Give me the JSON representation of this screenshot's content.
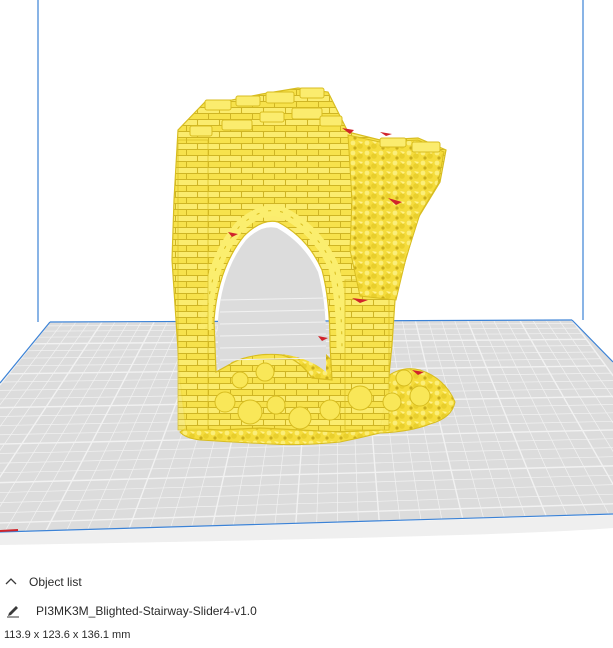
{
  "viewport": {
    "background": "#ffffff",
    "buildplate_color": "#dcdcdc",
    "grid_color": "#f2f2f2",
    "volume_edge_color": "#3b82d6",
    "model_color": "#f7e24c",
    "model_shadow_color": "#d8bd20",
    "overhang_color": "#d0242b"
  },
  "object_panel": {
    "toggle_icon": "chevron-up-icon",
    "title": "Object list",
    "edit_icon": "pencil-icon",
    "object_name": "PI3MK3M_Blighted-Stairway-Slider4-v1.0",
    "dimensions": "113.9 x 123.6 x 136.1 mm"
  }
}
